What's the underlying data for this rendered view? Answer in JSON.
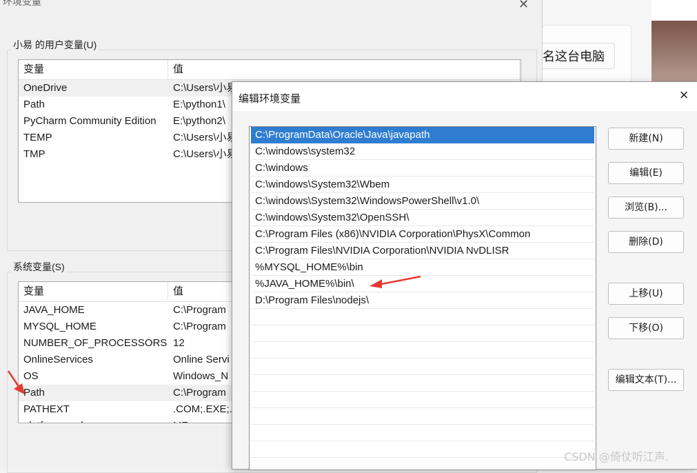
{
  "background_window": {
    "rename_button": "名这台电脑"
  },
  "env_dialog": {
    "title": "环境变量",
    "user_group_label": "小易 的用户变量(U)",
    "system_group_label": "系统变量(S)",
    "columns": [
      "变量",
      "值"
    ],
    "user_vars": [
      {
        "name": "OneDrive",
        "value": "C:\\Users\\小易"
      },
      {
        "name": "Path",
        "value": "E:\\python1\\"
      },
      {
        "name": "PyCharm Community Edition",
        "value": "E:\\python2\\"
      },
      {
        "name": "TEMP",
        "value": "C:\\Users\\小易"
      },
      {
        "name": "TMP",
        "value": "C:\\Users\\小易"
      }
    ],
    "system_vars": [
      {
        "name": "JAVA_HOME",
        "value": "C:\\Program"
      },
      {
        "name": "MYSQL_HOME",
        "value": "C:\\Program"
      },
      {
        "name": "NUMBER_OF_PROCESSORS",
        "value": "12"
      },
      {
        "name": "OnlineServices",
        "value": "Online Servi"
      },
      {
        "name": "OS",
        "value": "Windows_N"
      },
      {
        "name": "Path",
        "value": "C:\\Program"
      },
      {
        "name": "PATHEXT",
        "value": ".COM;.EXE;."
      },
      {
        "name": "platform_code",
        "value": "MZ"
      }
    ]
  },
  "edit_dialog": {
    "title": "编辑环境变量",
    "paths": [
      "C:\\ProgramData\\Oracle\\Java\\javapath",
      "C:\\windows\\system32",
      "C:\\windows",
      "C:\\windows\\System32\\Wbem",
      "C:\\windows\\System32\\WindowsPowerShell\\v1.0\\",
      "C:\\windows\\System32\\OpenSSH\\",
      "C:\\Program Files (x86)\\NVIDIA Corporation\\PhysX\\Common",
      "C:\\Program Files\\NVIDIA Corporation\\NVIDIA NvDLISR",
      "%MYSQL_HOME%\\bin",
      "%JAVA_HOME%\\bin\\",
      "D:\\Program Files\\nodejs\\"
    ],
    "buttons": {
      "new": "新建(N)",
      "edit": "编辑(E)",
      "browse": "浏览(B)...",
      "delete": "删除(D)",
      "move_up": "上移(U)",
      "move_down": "下移(O)",
      "edit_text": "编辑文本(T)..."
    }
  },
  "watermark": "CSDN @倚仗听江声.",
  "colors": {
    "selection": "#2f7dd1",
    "annotation_arrow": "#e53935"
  }
}
